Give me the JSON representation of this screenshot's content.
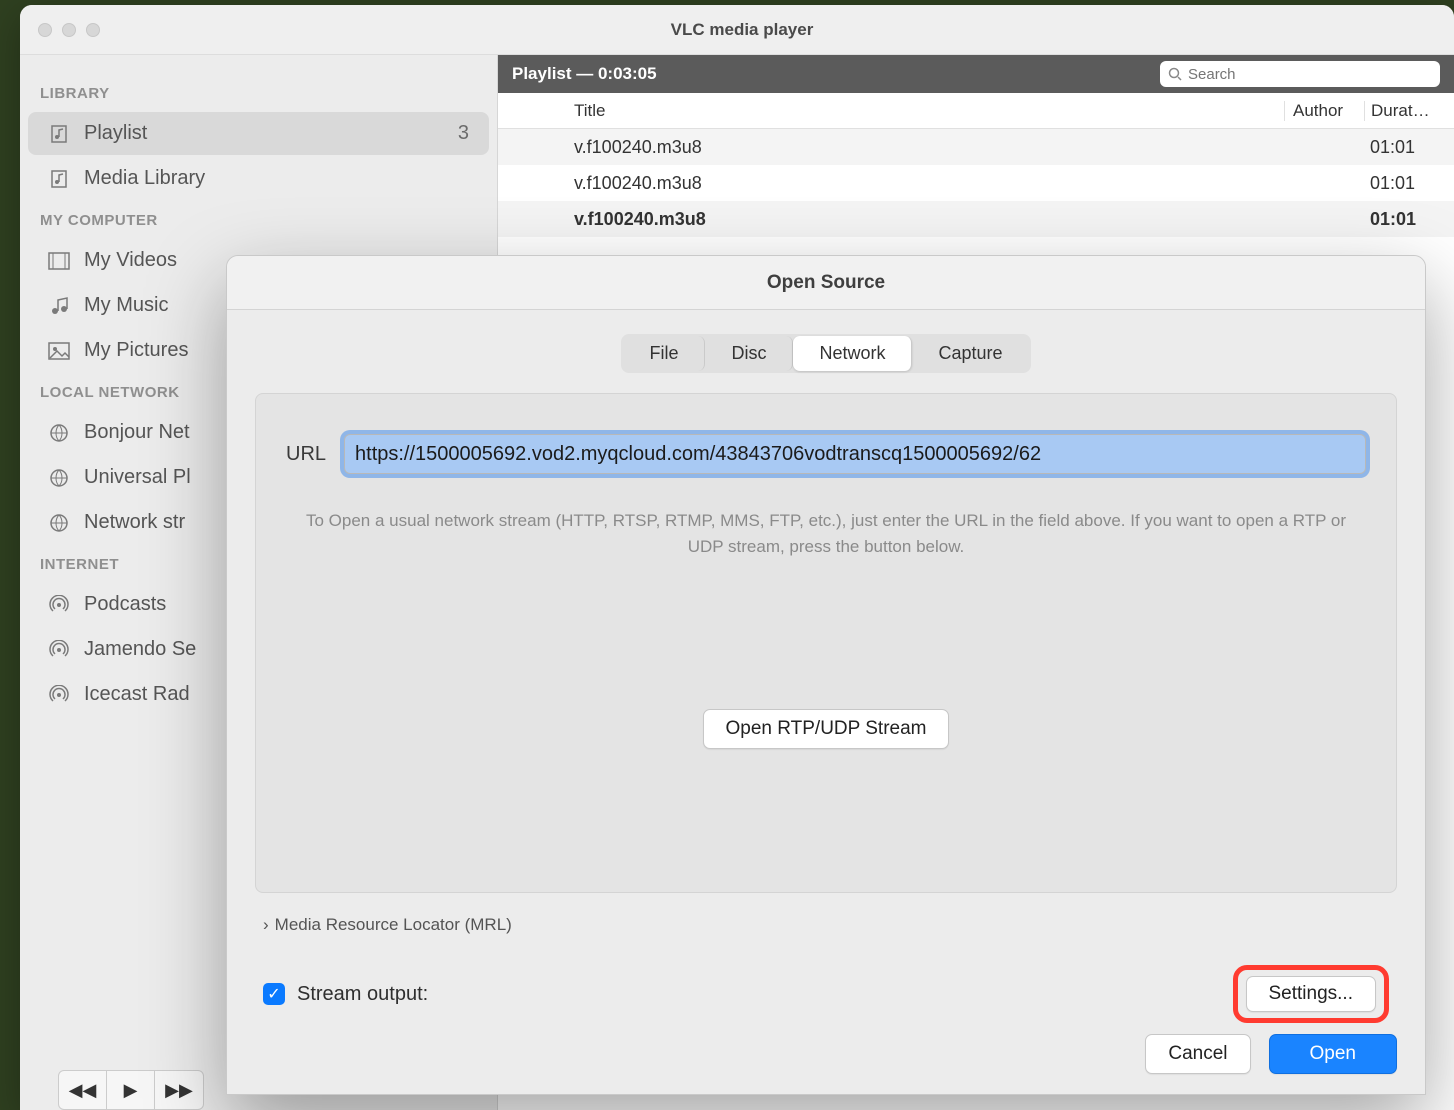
{
  "window": {
    "title": "VLC media player"
  },
  "sidebar": {
    "sections": [
      {
        "header": "LIBRARY",
        "items": [
          {
            "label": "Playlist",
            "count": "3",
            "selected": true
          },
          {
            "label": "Media Library"
          }
        ]
      },
      {
        "header": "MY COMPUTER",
        "items": [
          {
            "label": "My Videos"
          },
          {
            "label": "My Music"
          },
          {
            "label": "My Pictures"
          }
        ]
      },
      {
        "header": "LOCAL NETWORK",
        "items": [
          {
            "label": "Bonjour Net"
          },
          {
            "label": "Universal Pl"
          },
          {
            "label": "Network str"
          }
        ]
      },
      {
        "header": "INTERNET",
        "items": [
          {
            "label": "Podcasts"
          },
          {
            "label": "Jamendo Se"
          },
          {
            "label": "Icecast Rad"
          }
        ]
      }
    ]
  },
  "playlist_header": {
    "text": "Playlist — 0:03:05",
    "search_placeholder": "Search"
  },
  "columns": {
    "title": "Title",
    "author": "Author",
    "duration": "Durat…"
  },
  "rows": [
    {
      "title": "v.f100240.m3u8",
      "duration": "01:01",
      "bold": false
    },
    {
      "title": "v.f100240.m3u8",
      "duration": "01:01",
      "bold": false
    },
    {
      "title": "v.f100240.m3u8",
      "duration": "01:01",
      "bold": true
    }
  ],
  "dialog": {
    "title": "Open Source",
    "tabs": [
      "File",
      "Disc",
      "Network",
      "Capture"
    ],
    "active_tab": "Network",
    "url_label": "URL",
    "url_value": "https://1500005692.vod2.myqcloud.com/43843706vodtranscq1500005692/62",
    "hint": "To Open a usual network stream (HTTP, RTSP, RTMP, MMS, FTP, etc.), just enter the URL in the field above. If you want to open a RTP or UDP stream, press the button below.",
    "rtp_button": "Open RTP/UDP Stream",
    "mrl": "Media Resource Locator (MRL)",
    "stream_output_label": "Stream output:",
    "stream_output_checked": true,
    "settings_button": "Settings...",
    "cancel": "Cancel",
    "open": "Open"
  }
}
